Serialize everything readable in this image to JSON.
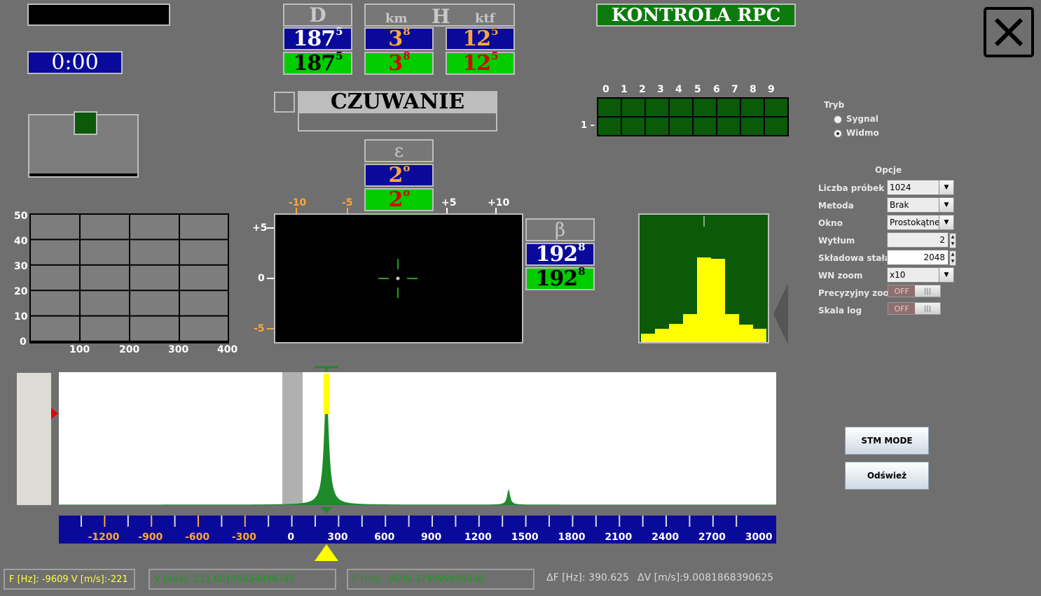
{
  "top": {
    "timer": "0:00",
    "app_title": "KONTROLA RPC",
    "d_header": "D",
    "h_header": "H",
    "h_unit_left": "km",
    "h_unit_right": "ktf",
    "d_blue": {
      "main": "187",
      "sup": "5"
    },
    "d_green": {
      "main": "187",
      "sup": "5"
    },
    "h_km_blue": {
      "main": "3",
      "sup": "8"
    },
    "h_km_green": {
      "main": "3",
      "sup": "8"
    },
    "h_ktf_blue": {
      "main": "12",
      "sup": "5"
    },
    "h_ktf_green": {
      "main": "12",
      "sup": "5"
    },
    "status_label": "CZUWANIE",
    "eps_header": "ε",
    "eps_blue": {
      "main": "2",
      "sup": "o"
    },
    "eps_green": {
      "main": "2",
      "sup": "o"
    },
    "beta_header": "β",
    "beta_blue": {
      "main": "192",
      "sup": "8"
    },
    "beta_green": {
      "main": "192",
      "sup": "8"
    }
  },
  "digit_grid": {
    "columns": [
      "0",
      "1",
      "2",
      "3",
      "4",
      "5",
      "6",
      "7",
      "8",
      "9"
    ],
    "row_label": "1 –"
  },
  "small_grid": {
    "y_ticks": [
      "50",
      "40",
      "30",
      "20",
      "10",
      "0"
    ],
    "x_ticks": [
      "100",
      "200",
      "300",
      "400"
    ]
  },
  "scope": {
    "x_ticks": [
      "-10",
      "-5",
      "+5",
      "+10"
    ],
    "y_ticks": [
      "+5",
      "0",
      "-5"
    ]
  },
  "spectrum_scale": {
    "labels": [
      "-1200",
      "-900",
      "-600",
      "-300",
      "0",
      "300",
      "600",
      "900",
      "1200",
      "1500",
      "1800",
      "2100",
      "2400",
      "2700",
      "3000"
    ]
  },
  "right_panel": {
    "mode_title": "Tryb",
    "mode_options": [
      "Sygnal",
      "Widmo"
    ],
    "mode_selected": "Widmo",
    "options_title": "Opcje",
    "fields": [
      {
        "label": "Liczba próbek",
        "type": "combo",
        "value": "1024"
      },
      {
        "label": "Metoda",
        "type": "combo",
        "value": "Brak"
      },
      {
        "label": "Okno",
        "type": "combo",
        "value": "Prostokątne"
      },
      {
        "label": "Wytłum",
        "type": "spin",
        "value": "2"
      },
      {
        "label": "Składowa stała",
        "type": "spin",
        "value": "2048"
      },
      {
        "label": "WN zoom",
        "type": "combo",
        "value": "x10"
      },
      {
        "label": "Precyzyjny zoom",
        "type": "toggle",
        "value": "OFF"
      },
      {
        "label": "Skala log",
        "type": "toggle",
        "value": "OFF"
      }
    ],
    "stm_button": "STM MODE",
    "refresh_button": "Odśwież"
  },
  "status_bar": {
    "fv": "F [Hz]: -9609    V [m/s]:-221",
    "v_precise": "V [m/s]:-221.60195624999745",
    "f_precise": "F [Hz]: -9609.374999999996",
    "delta_f": "ΔF [Hz]: 390.625",
    "delta_v": "ΔV [m/s]:9.0081868390625"
  },
  "colors": {
    "background": "#6f6f6f",
    "value_blue": "#0a0a9a",
    "value_green": "#00cc00",
    "title_green": "#0d7a0d",
    "spectrum_green": "#1e8a2a",
    "marker_yellow": "#ffff00",
    "status_yellow": "#ffff44"
  }
}
